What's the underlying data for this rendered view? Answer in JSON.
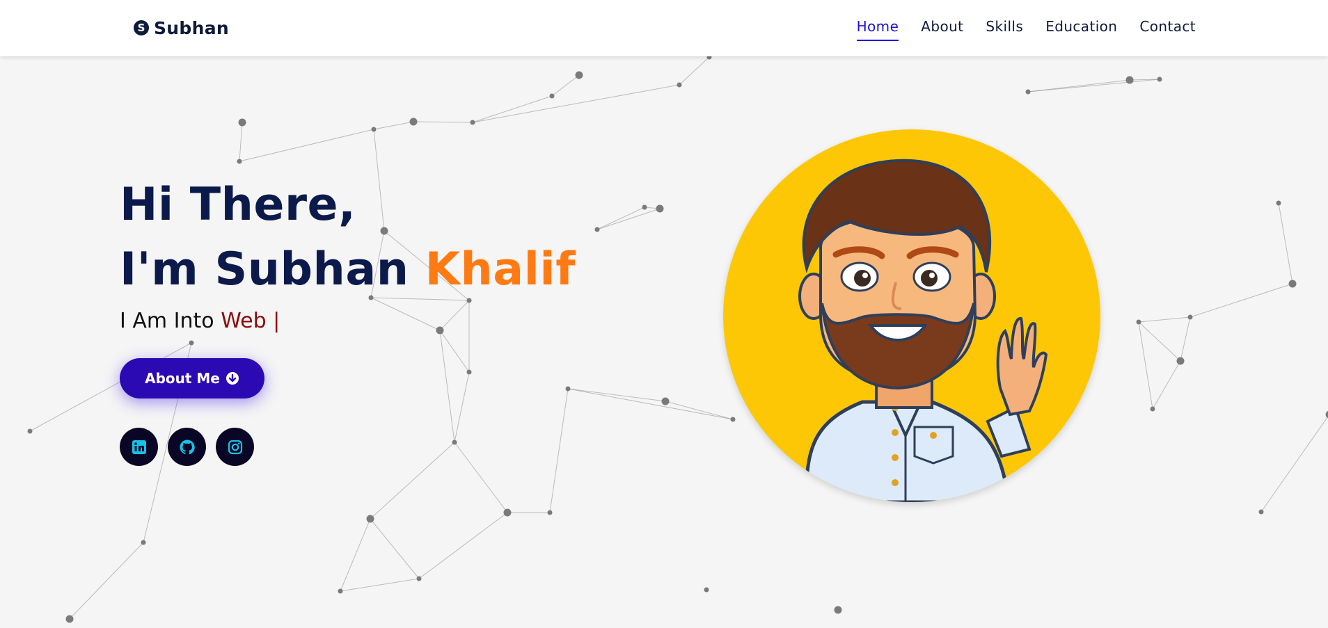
{
  "brand": {
    "name": "Subhan",
    "icon": "skype-icon"
  },
  "nav": {
    "items": [
      {
        "label": "Home",
        "active": true
      },
      {
        "label": "About",
        "active": false
      },
      {
        "label": "Skills",
        "active": false
      },
      {
        "label": "Education",
        "active": false
      },
      {
        "label": "Contact",
        "active": false
      }
    ]
  },
  "hero": {
    "greeting": "Hi There,",
    "intro_prefix": "I'm Subhan",
    "intro_highlight": "Khalif",
    "typed_prefix": "I Am Into",
    "typed_word": "Web |",
    "button_label": "About Me",
    "button_icon": "arrow-down-circle-icon"
  },
  "socials": [
    {
      "name": "linkedin",
      "icon": "linkedin-icon"
    },
    {
      "name": "github",
      "icon": "github-icon"
    },
    {
      "name": "instagram",
      "icon": "instagram-icon"
    }
  ],
  "colors": {
    "accent": "#ff7a12",
    "heading": "#0c1a4b",
    "typed_word": "#8b0c0c",
    "button": "#2c0ab3",
    "nav_active": "#1a10d8",
    "avatar_bg": "#fdc705",
    "social_bg": "#0a0625",
    "social_icon": "#16c2e8"
  }
}
